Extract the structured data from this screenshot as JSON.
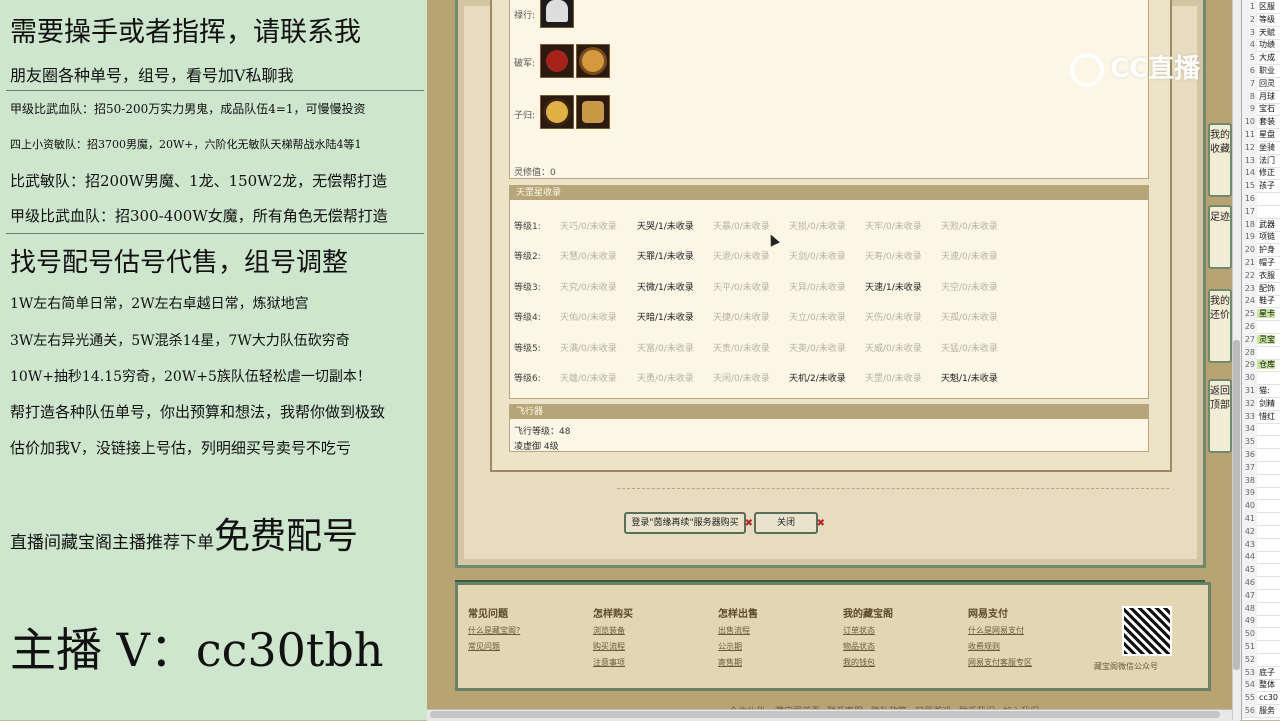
{
  "overlay": {
    "lines": [
      "需要操手或者指挥，请联系我",
      "朋友圈各种单号，组号，看号加V私聊我",
      "甲级比武血队：招50-200万实力男鬼，成品队伍4=1，可慢慢投资",
      "四上小资敏队：招3700男魔，20W+，六阶化无敏队天梯帮战水陆4等1",
      "比武敏队：招200W男魔、1龙、150W2龙，无偿帮打造",
      "甲级比武血队：招300-400W女魔，所有角色无偿帮打造",
      "找号配号估号代售，组号调整",
      "1W左右简单日常，2W左右卓越日常，炼狱地宫",
      "3W左右异光通关，5W混杀14星，7W大力队伍砍穷奇",
      "10W+抽秒14.15穷奇，20W+5族队伍轻松虐一切副本！",
      "帮打造各种队伍单号，你出预算和想法，我帮你做到极致",
      "估价加我V，没链接上号估，列明细买号卖号不吃亏"
    ],
    "recommend_prefix": "直播间藏宝阁主播推荐下单",
    "recommend_big": "免费配号",
    "anchor": "主播 V：cc30tbh"
  },
  "equip": {
    "rows": [
      {
        "label": "禄行:"
      },
      {
        "label": "破军:"
      },
      {
        "label": "子归:"
      }
    ],
    "spirit_label": "灵修值：0"
  },
  "star_section": {
    "title": "天罡星收录",
    "rows": [
      {
        "level": "等级1:",
        "cells": [
          {
            "t": "天巧/0/未收录",
            "on": false
          },
          {
            "t": "天哭/1/未收录",
            "on": true
          },
          {
            "t": "天暴/0/未收录",
            "on": false
          },
          {
            "t": "天损/0/未收录",
            "on": false
          },
          {
            "t": "天牢/0/未收录",
            "on": false
          },
          {
            "t": "天败/0/未收录",
            "on": false
          }
        ]
      },
      {
        "level": "等级2:",
        "cells": [
          {
            "t": "天慧/0/未收录",
            "on": false
          },
          {
            "t": "天罪/1/未收录",
            "on": true
          },
          {
            "t": "天退/0/未收录",
            "on": false
          },
          {
            "t": "天剑/0/未收录",
            "on": false
          },
          {
            "t": "天寿/0/未收录",
            "on": false
          },
          {
            "t": "天速/0/未收录",
            "on": false
          }
        ]
      },
      {
        "level": "等级3:",
        "cells": [
          {
            "t": "天究/0/未收录",
            "on": false
          },
          {
            "t": "天微/1/未收录",
            "on": true
          },
          {
            "t": "天平/0/未收录",
            "on": false
          },
          {
            "t": "天异/0/未收录",
            "on": false
          },
          {
            "t": "天速/1/未收录",
            "on": true
          },
          {
            "t": "天空/0/未收录",
            "on": false
          }
        ]
      },
      {
        "level": "等级4:",
        "cells": [
          {
            "t": "天佑/0/未收录",
            "on": false
          },
          {
            "t": "天暗/1/未收录",
            "on": true
          },
          {
            "t": "天捷/0/未收录",
            "on": false
          },
          {
            "t": "天立/0/未收录",
            "on": false
          },
          {
            "t": "天伤/0/未收录",
            "on": false
          },
          {
            "t": "天孤/0/未收录",
            "on": false
          }
        ]
      },
      {
        "level": "等级5:",
        "cells": [
          {
            "t": "天满/0/未收录",
            "on": false
          },
          {
            "t": "天富/0/未收录",
            "on": false
          },
          {
            "t": "天贵/0/未收录",
            "on": false
          },
          {
            "t": "天英/0/未收录",
            "on": false
          },
          {
            "t": "天威/0/未收录",
            "on": false
          },
          {
            "t": "天猛/0/未收录",
            "on": false
          }
        ]
      },
      {
        "level": "等级6:",
        "cells": [
          {
            "t": "天雄/0/未收录",
            "on": false
          },
          {
            "t": "天勇/0/未收录",
            "on": false
          },
          {
            "t": "天闲/0/未收录",
            "on": false
          },
          {
            "t": "天机/2/未收录",
            "on": true
          },
          {
            "t": "天罡/0/未收录",
            "on": false
          },
          {
            "t": "天魁/1/未收录",
            "on": true
          }
        ]
      }
    ]
  },
  "flight": {
    "title": "飞行器",
    "level_line": "飞行等级：48",
    "sub_line": "凌虚御   4级"
  },
  "buttons": {
    "login": "登录\"茵缘再续\"服务器购买",
    "close": "关闭"
  },
  "footer": {
    "columns": [
      {
        "title": "常见问题",
        "links": [
          "什么是藏宝阁?",
          "常见问题"
        ]
      },
      {
        "title": "怎样购买",
        "links": [
          "浏览装备",
          "购买流程",
          "注意事项"
        ]
      },
      {
        "title": "怎样出售",
        "links": [
          "出售流程",
          "公示期",
          "寄售期"
        ]
      },
      {
        "title": "我的藏宝阁",
        "links": [
          "订单状态",
          "物品状态",
          "我的钱包"
        ]
      },
      {
        "title": "网易支付",
        "links": [
          "什么是网易支付",
          "收费规则",
          "网易支付客服专区"
        ]
      }
    ],
    "qr_caption": "藏宝阁微信公众号",
    "bottom_links": [
      "合作伙伴",
      "藏宝阁首页",
      "联系客服",
      "隐私政策",
      "网易游戏",
      "联系我们",
      "加入我们"
    ]
  },
  "side_nav": [
    "我的收藏",
    "足迹",
    "我的还价",
    "返回顶部"
  ],
  "watermark": "CC直播",
  "sheet_rows": [
    {
      "n": "1",
      "t": "区服"
    },
    {
      "n": "2",
      "t": "等级"
    },
    {
      "n": "3",
      "t": "天赋"
    },
    {
      "n": "4",
      "t": "功绩"
    },
    {
      "n": "5",
      "t": "大成"
    },
    {
      "n": "6",
      "t": "职业"
    },
    {
      "n": "7",
      "t": "回灵"
    },
    {
      "n": "8",
      "t": "月球"
    },
    {
      "n": "9",
      "t": "宝石"
    },
    {
      "n": "10",
      "t": "套装"
    },
    {
      "n": "11",
      "t": "星盘"
    },
    {
      "n": "12",
      "t": "坐骑"
    },
    {
      "n": "13",
      "t": "法门"
    },
    {
      "n": "14",
      "t": "修正"
    },
    {
      "n": "15",
      "t": "孩子"
    },
    {
      "n": "16",
      "t": ""
    },
    {
      "n": "17",
      "t": ""
    },
    {
      "n": "18",
      "t": "武器"
    },
    {
      "n": "19",
      "t": "项链"
    },
    {
      "n": "20",
      "t": "护身"
    },
    {
      "n": "21",
      "t": "帽子"
    },
    {
      "n": "22",
      "t": "衣服"
    },
    {
      "n": "23",
      "t": "配饰"
    },
    {
      "n": "24",
      "t": "鞋子"
    },
    {
      "n": "25",
      "t": "星卡"
    },
    {
      "n": "26",
      "t": ""
    },
    {
      "n": "27",
      "t": "灵宝"
    },
    {
      "n": "28",
      "t": ""
    },
    {
      "n": "29",
      "t": "仓库"
    },
    {
      "n": "30",
      "t": ""
    },
    {
      "n": "31",
      "t": "猫:"
    },
    {
      "n": "32",
      "t": "剑精"
    },
    {
      "n": "33",
      "t": "惜红"
    },
    {
      "n": "34",
      "t": ""
    },
    {
      "n": "35",
      "t": ""
    },
    {
      "n": "36",
      "t": ""
    },
    {
      "n": "37",
      "t": ""
    },
    {
      "n": "38",
      "t": ""
    },
    {
      "n": "39",
      "t": ""
    },
    {
      "n": "40",
      "t": ""
    },
    {
      "n": "41",
      "t": ""
    },
    {
      "n": "42",
      "t": ""
    },
    {
      "n": "43",
      "t": ""
    },
    {
      "n": "44",
      "t": ""
    },
    {
      "n": "45",
      "t": ""
    },
    {
      "n": "46",
      "t": ""
    },
    {
      "n": "47",
      "t": ""
    },
    {
      "n": "48",
      "t": ""
    },
    {
      "n": "49",
      "t": ""
    },
    {
      "n": "50",
      "t": ""
    },
    {
      "n": "51",
      "t": ""
    },
    {
      "n": "52",
      "t": ""
    },
    {
      "n": "53",
      "t": "底子"
    },
    {
      "n": "54",
      "t": "整体"
    },
    {
      "n": "55",
      "t": "cc30"
    },
    {
      "n": "56",
      "t": "服务"
    }
  ]
}
